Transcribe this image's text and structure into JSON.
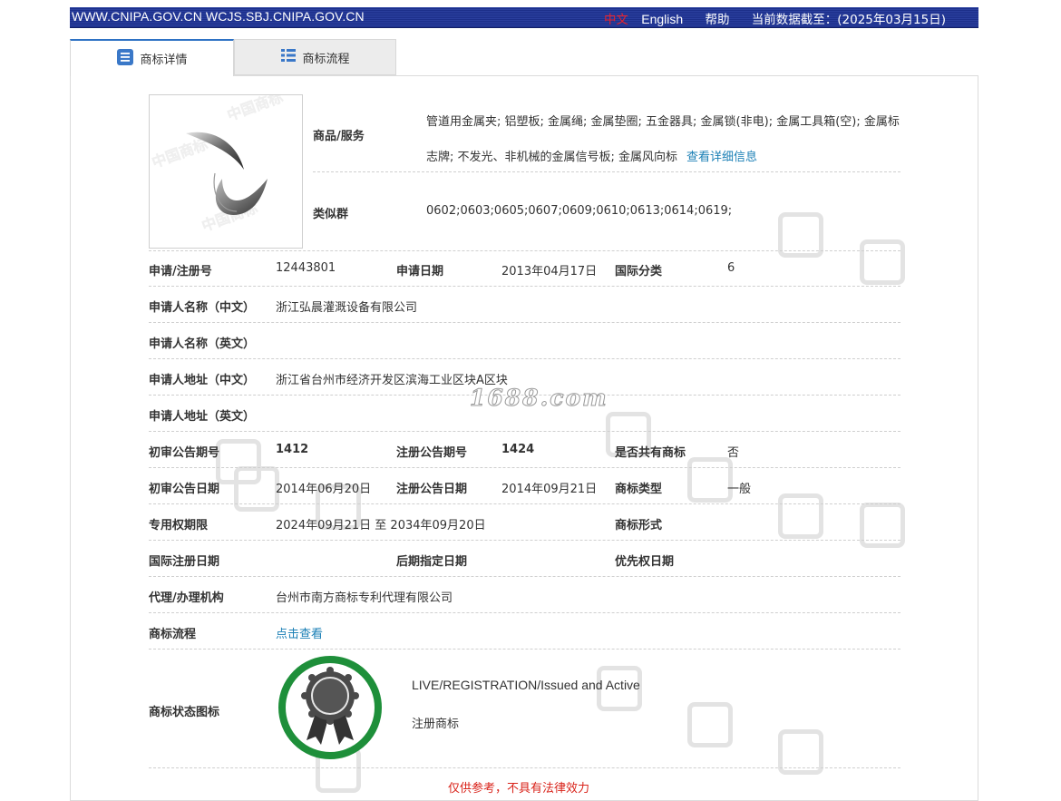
{
  "header": {
    "site_domains": "WWW.CNIPA.GOV.CN WCJS.SBJ.CNIPA.GOV.CN",
    "lang_cn": "中文",
    "lang_en": "English",
    "help": "帮助",
    "data_as_of": "当前数据截至：(2025年03月15日)",
    "background_color": "#1c2f8a"
  },
  "tabs": [
    {
      "label": "商标详情",
      "icon": "document-list-icon",
      "active": true
    },
    {
      "label": "商标流程",
      "icon": "grid-list-icon",
      "active": false
    }
  ],
  "watermark_text": "1688.com",
  "detail": {
    "goods_label": "商品/服务",
    "goods_text": "管道用金属夹; 铝塑板; 金属绳; 金属垫圈; 五金器具; 金属锁(非电); 金属工具箱(空); 金属标志牌; 不发光、非机械的金属信号板; 金属风向标",
    "goods_link": "查看详细信息",
    "similar_label": "类似群",
    "similar_value": "0602;0603;0605;0607;0609;0610;0613;0614;0619;",
    "reg_no_label": "申请/注册号",
    "reg_no": "12443801",
    "apply_date_label": "申请日期",
    "apply_date": "2013年04月17日",
    "intl_class_label": "国际分类",
    "intl_class": "6",
    "applicant_cn_label": "申请人名称（中文）",
    "applicant_cn": "浙江弘晨灌溉设备有限公司",
    "applicant_en_label": "申请人名称（英文）",
    "applicant_en": "",
    "address_cn_label": "申请人地址（中文）",
    "address_cn": "浙江省台州市经济开发区滨海工业区块A区块",
    "address_en_label": "申请人地址（英文）",
    "address_en": "",
    "prelim_issue_label": "初审公告期号",
    "prelim_issue": "1412",
    "reg_issue_label": "注册公告期号",
    "reg_issue": "1424",
    "shared_label": "是否共有商标",
    "shared": "否",
    "prelim_date_label": "初审公告日期",
    "prelim_date": "2014年06月20日",
    "reg_date_label": "注册公告日期",
    "reg_date": "2014年09月21日",
    "tm_type_label": "商标类型",
    "tm_type": "一般",
    "exclusive_label": "专用权期限",
    "exclusive": "2024年09月21日 至 2034年09月20日",
    "tm_form_label": "商标形式",
    "tm_form": "",
    "intl_reg_date_label": "国际注册日期",
    "later_designation_label": "后期指定日期",
    "priority_date_label": "优先权日期",
    "agency_label": "代理/办理机构",
    "agency": "台州市南方商标专利代理有限公司",
    "flow_label": "商标流程",
    "flow_link": "点击查看",
    "status_icon_label": "商标状态图标",
    "status_en": "LIVE/REGISTRATION/Issued and Active",
    "status_cn": "注册商标",
    "status_ring_color": "#1e8f3a",
    "disclaimer": "仅供参考，不具有法律效力"
  }
}
